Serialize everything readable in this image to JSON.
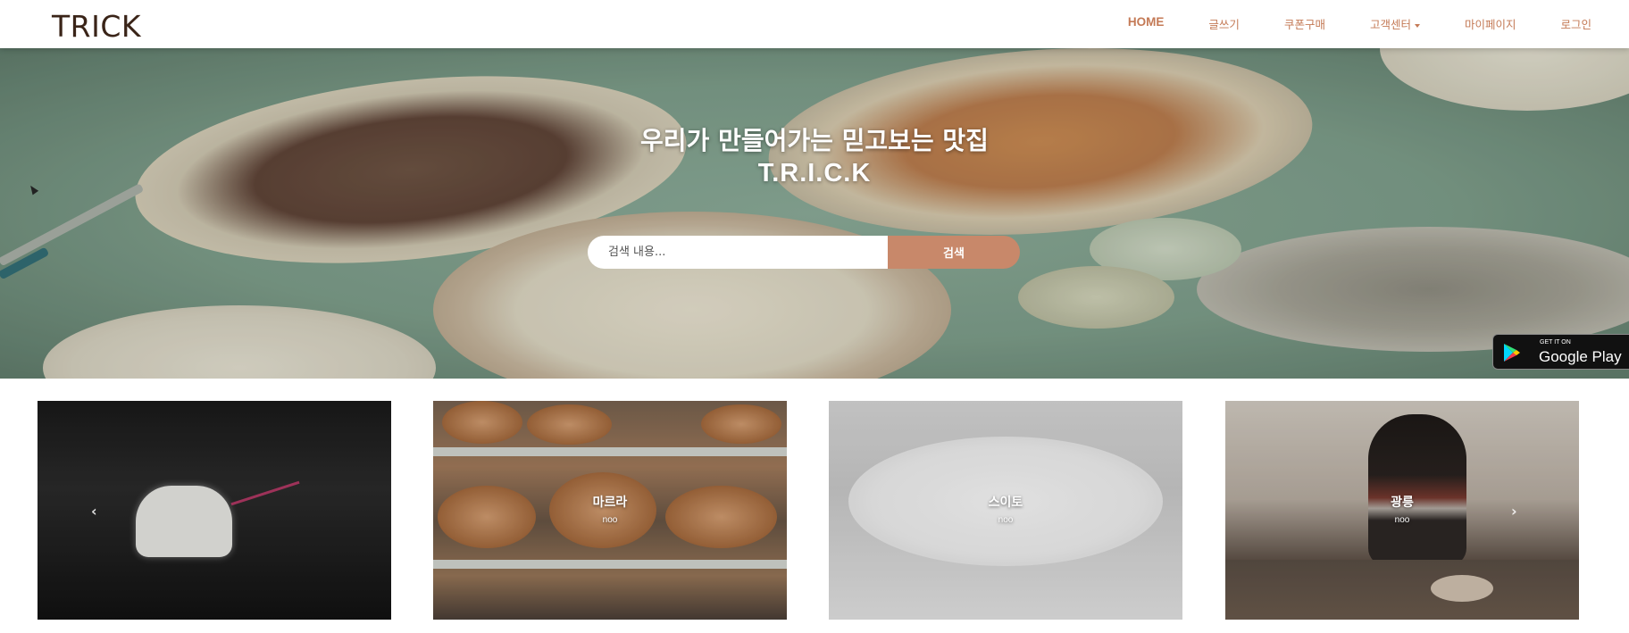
{
  "brand": {
    "name": "TRICK"
  },
  "nav": {
    "items": [
      {
        "label": "HOME"
      },
      {
        "label": "글쓰기"
      },
      {
        "label": "쿠폰구매"
      },
      {
        "label": "고객센터"
      },
      {
        "label": "마이페이지"
      },
      {
        "label": "로그인"
      }
    ]
  },
  "hero": {
    "title": "우리가 만들어가는 믿고보는 맛집",
    "subtitle": "T.R.I.C.K",
    "search": {
      "placeholder": "검색 내용...",
      "button_label": "검색"
    },
    "store_badge": {
      "small": "GET IT ON",
      "big": "Google Play",
      "icon": "google-play-icon"
    }
  },
  "cards": [
    {
      "title": "",
      "sub": "",
      "has_prev": true,
      "has_next": false
    },
    {
      "title": "마르라",
      "sub": "noo",
      "has_prev": false,
      "has_next": false
    },
    {
      "title": "스이토",
      "sub": "noo",
      "has_prev": false,
      "has_next": false
    },
    {
      "title": "광릉",
      "sub": "noo",
      "has_prev": false,
      "has_next": true
    }
  ],
  "colors": {
    "accent": "#c8886a",
    "nav_text": "#c47a56",
    "brand_text": "#3a2418",
    "brand_highlight": "#b5382c"
  }
}
